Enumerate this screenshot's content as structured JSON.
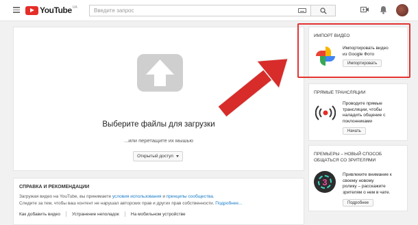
{
  "header": {
    "logo_text": "YouTube",
    "logo_region": "UA",
    "search_placeholder": "Введите запрос"
  },
  "upload": {
    "title": "Выберите файлы для загрузки",
    "subtitle": "...или перетащите их мышью",
    "privacy_label": "Открытый доступ"
  },
  "help": {
    "title": "СПРАВКА И РЕКОМЕНДАЦИИ",
    "line1_prefix": "Загружая видео на YouTube, вы принимаете ",
    "line1_link1": "условия использования",
    "line1_mid": " и ",
    "line1_link2": "принципы сообщества",
    "line1_suffix": ".",
    "line2_text": "Следите за тем, чтобы ваш контент не нарушал авторских прав и других прав собственности. ",
    "line2_link": "Подробнее...",
    "links": [
      "Как добавить видео",
      "Устранение неполадок",
      "На мобильном устройстве"
    ]
  },
  "cards": {
    "import": {
      "title": "ИМПОРТ ВИДЕО",
      "text_line1": "Импортировать видео",
      "text_line2": "из Google Фото",
      "button": "Импортировать"
    },
    "live": {
      "title": "ПРЯМЫЕ ТРАНСЛЯЦИИ",
      "text_line1": "Проводите прямые",
      "text_line2": "трансляции, чтобы",
      "text_line3": "наладить общение с",
      "text_line4": "поклонниками",
      "button": "Начать"
    },
    "premiere": {
      "title_line1": "ПРЕМЬЕРЫ – НОВЫЙ СПОСОБ",
      "title_line2": "ОБЩАТЬСЯ СО ЗРИТЕЛЯМИ",
      "badge": "3",
      "text_line1": "Привлеките внимание к",
      "text_line2": "своему новому",
      "text_line3": "ролику – расскажите",
      "text_line4": "зрителям о нем в чате.",
      "button": "Подробнее"
    }
  },
  "colors": {
    "youtube_red": "#e52d27",
    "link_blue": "#167ac6",
    "annotation_red": "#e3312f"
  }
}
